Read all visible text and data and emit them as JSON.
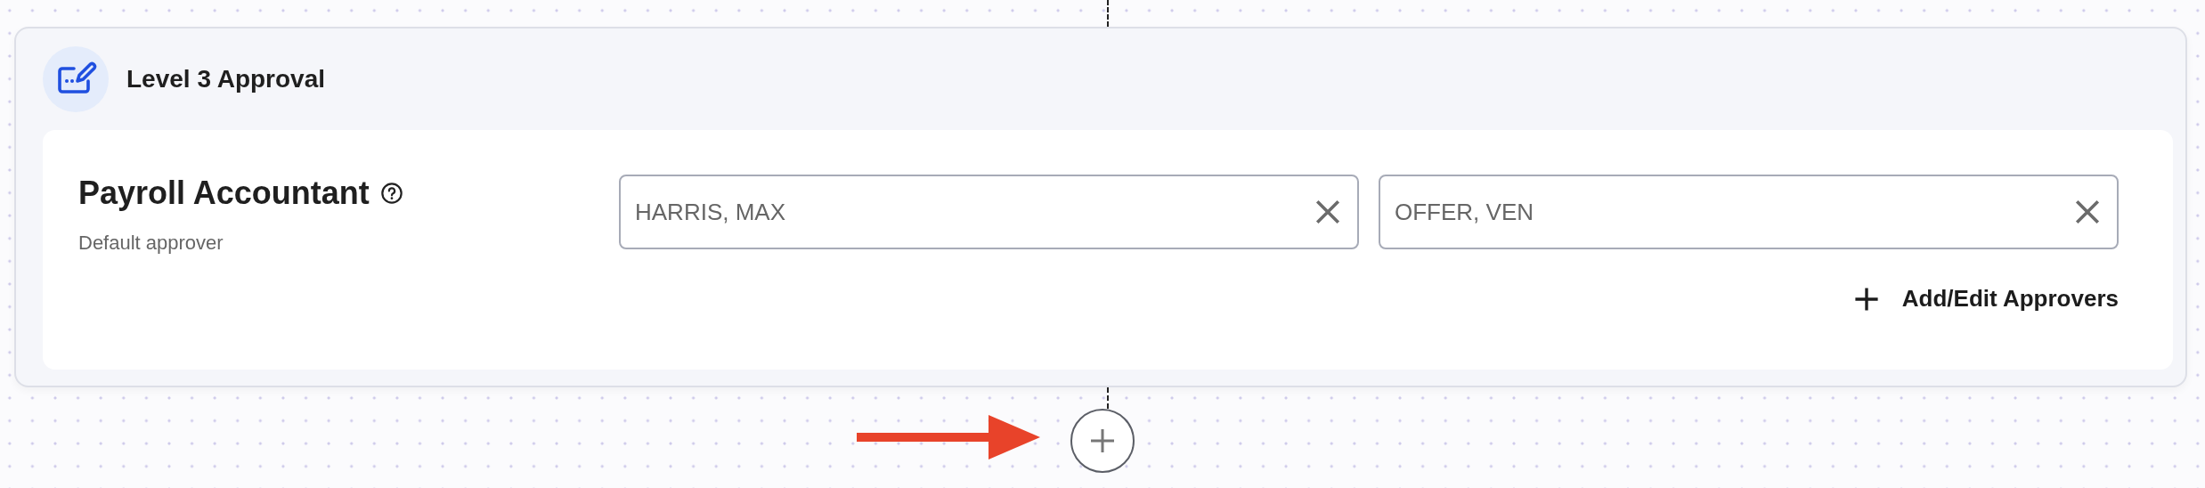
{
  "step": {
    "title": "Level 3 Approval",
    "role": {
      "name": "Payroll Accountant",
      "subtitle": "Default approver"
    },
    "approvers": [
      {
        "value": "HARRIS, MAX"
      },
      {
        "value": "OFFER, VEN"
      }
    ],
    "add_button": {
      "label": "Add/Edit Approvers"
    }
  }
}
